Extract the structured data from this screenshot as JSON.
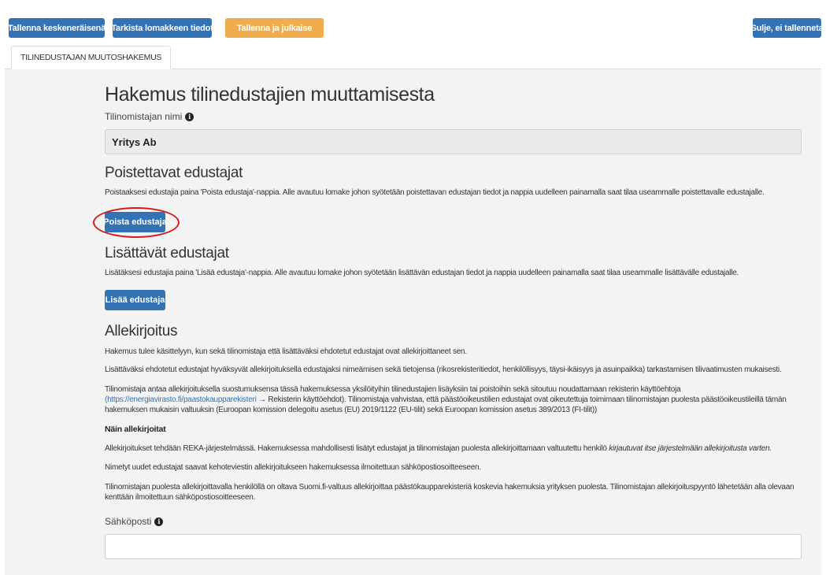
{
  "toolbar": {
    "save_draft": "Tallenna keskeneräisenä",
    "check_form": "Tarkista lomakkeen tiedot",
    "save_publish": "Tallenna ja julkaise",
    "close_no_save": "Sulje, ei tallenneta"
  },
  "tabs": [
    {
      "label": "TILINEDUSTAJAN MUUTOSHAKEMUS"
    }
  ],
  "form": {
    "title": "Hakemus tilinedustajien muuttamisesta",
    "owner_label": "Tilinomistajan nimi",
    "owner_value": "Yritys Ab",
    "remove_section": {
      "heading": "Poistettavat edustajat",
      "text": "Poistaaksesi edustajia paina 'Poista edustaja'-nappia. Alle avautuu lomake johon syötetään poistettavan edustajan tiedot ja nappia uudelleen painamalla saat tilaa useammalle poistettavalle edustajalle.",
      "button": "Poista edustaja"
    },
    "add_section": {
      "heading": "Lisättävät edustajat",
      "text": "Lisätäksesi edustajia paina 'Lisää edustaja'-nappia. Alle avautuu lomake johon syötetään lisättävän edustajan tiedot ja nappia uudelleen painamalla saat tilaa useammalle lisättävälle edustajalle.",
      "button": "Lisää edustaja"
    },
    "signature": {
      "heading": "Allekirjoitus",
      "p1": "Hakemus tulee käsittelyyn, kun sekä tilinomistaja että lisättäväksi ehdotetut edustajat ovat allekirjoittaneet sen.",
      "p2": "Lisättäväksi ehdotetut edustajat hyväksyvät allekirjoituksella edustajaksi nimeämisen sekä tietojensa (rikosrekisteritiedot, henkilöllisyys, täysi-ikäisyys ja asuinpaikka) tarkastamisen tilivaatimusten mukaisesti.",
      "p3_line1": "Tilinomistaja antaa allekirjoituksella suostumuksensa tässä hakemuksessa yksilöityihin tilinedustajien lisäyksiin tai poistoihin sekä sitoutuu noudattamaan rekisterin käyttöehtoja",
      "p3_link": "(https://energiavirasto.fi/paastokaupparekisteri",
      "p3_arrow": "→",
      "p3_line2_rest": "Rekisterin käyttöehdot). Tilinomistaja vahvistaa, että päästöoikeustilien edustajat ovat oikeutettuja toimimaan tilinomistajan puolesta päästöoikeustileillä tämän",
      "p3_line3": "hakemuksen mukaisin valtuuksin (Euroopan komission delegoitu asetus (EU) 2019/1122 (EU-tilit) sekä Euroopan komission asetus 389/2013 (FI-tilit))",
      "how_heading": "Näin allekirjoitat",
      "p4_main": "Allekirjoitukset tehdään REKA-järjestelmässä. Hakemuksessa mahdollisesti lisätyt edustajat ja tilinomistajan puolesta allekirjoittamaan valtuutettu henkilö",
      "p4_italic": "kirjautuvat itse järjestelmään allekirjoitusta varten.",
      "p5": "Nimetyt uudet edustajat saavat kehoteviestin allekirjoitukseen hakemuksessa ilmoitettuun sähköpostiosoitteeseen.",
      "p6_line1": "Tilinomistajan puolesta allekirjoittavalla henkilöllä on oltava Suomi.fi-valtuus allekirjoittaa päästökaupparekisteriä koskevia hakemuksia yrityksen puolesta. Tilinomistajan allekirjoituspyyntö lähetetään alla olevaan",
      "p6_line2": "kenttään ilmoitettuun sähköpostiosoitteeseen.",
      "email_label": "Sähköposti"
    }
  },
  "icons": {
    "info": "info-icon"
  },
  "colors": {
    "primary": "#3373b4",
    "publish": "#f0ad4e",
    "highlight": "#d7191c",
    "panel_bg": "#f3f3f3"
  }
}
